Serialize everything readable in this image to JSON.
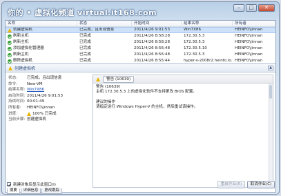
{
  "watermark": "你的 • 虚拟化频道 virtual.it168.com",
  "window_buttons": {
    "min": "–",
    "max": "□",
    "close": "✕"
  },
  "table": {
    "headers": [
      "名称",
      "状态",
      "开始时间",
      "结果名称",
      "所有者"
    ],
    "rows": [
      {
        "icon": "warning-icon",
        "name": "创建虚拟机",
        "status": "已完成，且出现信息",
        "start": "2011/4/26 9:01:53",
        "result": "Win7X86",
        "owner": "HEINFO\\jinnan",
        "selected": true
      },
      {
        "icon": "check-icon",
        "name": "刷新主机",
        "status": "已完成",
        "start": "2011/4/26 8:58:28",
        "result": "172.30.5.3",
        "owner": "HEINFO\\jinnan",
        "selected": false
      },
      {
        "icon": "check-icon",
        "name": "刷新主机",
        "status": "已完成",
        "start": "2011/4/26 8:58:28",
        "result": "172.30.5.3",
        "owner": "HEINFO\\jinnan",
        "selected": false
      },
      {
        "icon": "check-icon",
        "name": "添加虚拟化管理器",
        "status": "已完成",
        "start": "2011/4/26 8:56:48",
        "result": "172.30.5.10",
        "owner": "HEINFO\\jinnan",
        "selected": false
      },
      {
        "icon": "check-icon",
        "name": "刷新主机",
        "status": "已完成",
        "start": "2011/4/26 8:56:48",
        "result": "172.30.5.3",
        "owner": "HEINFO\\jinnan",
        "selected": false
      },
      {
        "icon": "check-icon",
        "name": "删除虚拟机",
        "status": "已完成",
        "start": "2011/4/26 8:55:44",
        "result": "hyper-v-2008r2.heinfo.lo...",
        "owner": "HEINFO\\jinnan",
        "selected": false
      }
    ]
  },
  "detail": {
    "title": "创建虚拟机",
    "collapse": "▲",
    "props": [
      {
        "key": "状态:",
        "value": "已完成，且出现信息"
      },
      {
        "key": "命令:",
        "value": "New-VM"
      },
      {
        "key": "结果名称:",
        "value": "Win7X86",
        "link": true
      },
      {
        "key": "启动时间:",
        "value": "2011/4/26 9:01:53"
      },
      {
        "key": "持续时间:",
        "value": "00:01:49"
      },
      {
        "key": "所有者:",
        "value": "HEINFO\\jinnan"
      },
      {
        "key": "进度:",
        "value": "100% 已完成",
        "warn": true
      },
      {
        "key": "当前步骤:",
        "value": "创建虚拟机"
      }
    ]
  },
  "message": {
    "tab_label": "警告 (10639)",
    "lines": [
      "警告 (10639)",
      "主机 172.30.5.3 上的虚拟化软件不支持更改 BIOS 配置。",
      "",
      "建议的操作",
      "请指定运行 Windows Hyper-V 的主机，然后重试该操作。"
    ]
  },
  "tabs": [
    "摘要",
    "详细信息",
    "更改跟踪"
  ],
  "bottom": {
    "checkbox_label": "新建对象后显示此窗口(I)",
    "restart_button": "重启作业(R)",
    "cancel_button": "取消作业(C)"
  }
}
